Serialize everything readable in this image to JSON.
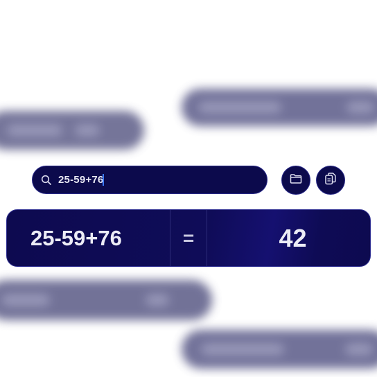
{
  "search": {
    "value": "25-59+76",
    "icon": "search-icon"
  },
  "toolbar": {
    "folder_icon": "folder-icon",
    "copy_icon": "copy-icon"
  },
  "result_card": {
    "expression": "25-59+76",
    "equals": "=",
    "result": "42"
  },
  "colors": {
    "panel": "#0c0a4c",
    "border": "#2a2a8a",
    "text": "#e8e8f4",
    "caret": "#3b7bff",
    "background": "#ffffff"
  }
}
